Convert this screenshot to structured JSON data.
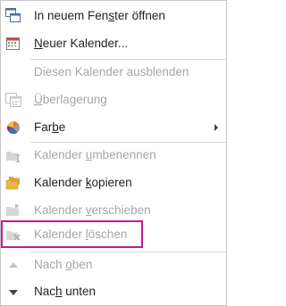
{
  "menu": {
    "items": [
      {
        "id": "open-new-window",
        "pre": "In neuem Fen",
        "acc": "s",
        "post": "ter öffnen",
        "icon": "window-icon",
        "disabled": false
      },
      {
        "id": "new-calendar",
        "pre": "",
        "acc": "N",
        "post": "euer Kalender...",
        "icon": "calendar-icon",
        "disabled": false
      },
      {
        "id": "hide-calendar",
        "pre": "Diesen Kalender ausblenden",
        "acc": "",
        "post": "",
        "icon": "",
        "disabled": true
      },
      {
        "id": "overlay",
        "pre": "",
        "acc": "Ü",
        "post": "berlagerung",
        "icon": "overlay-icon",
        "disabled": true
      },
      {
        "id": "color",
        "pre": "Far",
        "acc": "b",
        "post": "e",
        "icon": "color-palette-icon",
        "disabled": false,
        "submenu": true
      },
      {
        "id": "rename-calendar",
        "pre": "Kalender ",
        "acc": "u",
        "post": "mbenennen",
        "icon": "rename-folder-icon",
        "disabled": true
      },
      {
        "id": "copy-calendar",
        "pre": "Kalender ",
        "acc": "k",
        "post": "opieren",
        "icon": "copy-folder-icon",
        "disabled": false
      },
      {
        "id": "move-calendar",
        "pre": "Kalender ",
        "acc": "v",
        "post": "erschieben",
        "icon": "move-folder-icon",
        "disabled": true
      },
      {
        "id": "delete-calendar",
        "pre": "Kalender ",
        "acc": "l",
        "post": "öschen",
        "icon": "delete-folder-icon",
        "disabled": true
      },
      {
        "id": "move-up",
        "pre": "Nach ",
        "acc": "o",
        "post": "ben",
        "icon": "triangle-up-icon",
        "disabled": true
      },
      {
        "id": "move-down",
        "pre": "Nac",
        "acc": "h",
        "post": " unten",
        "icon": "triangle-down-icon",
        "disabled": false
      }
    ]
  },
  "colors": {
    "highlight_border": "#c71b8d",
    "disabled_text": "#a6a6a6",
    "text": "#1f1f1f"
  }
}
